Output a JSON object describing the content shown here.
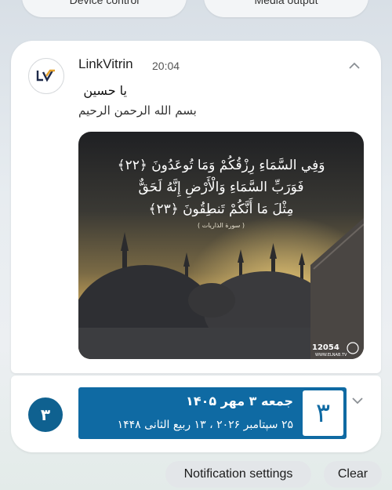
{
  "quick_settings": {
    "left_tile": "Device control",
    "right_tile": "Media output"
  },
  "notification": {
    "app_name": "LinkVitrin",
    "time": "20:04",
    "title": "یا حسین",
    "body": "بسم الله الرحمن الرحیم",
    "image": {
      "verse_line1": "وَفِي السَّمَاءِ رِزْقُكُمْ وَمَا تُوعَدُونَ ﴿٢٢﴾",
      "verse_line2": "فَوَرَبِّ السَّمَاءِ وَالْأَرْضِ إِنَّهُ لَحَقٌّ",
      "verse_line3": "مِثْلَ مَا أَنَّكُمْ تَنطِقُونَ ﴿٢٣﴾",
      "verse_ref": "( سورة الذاريات )",
      "channel_id": "12054",
      "site": "WWW.ELNAB.TV"
    }
  },
  "calendar_notification": {
    "icon_digit": "۳",
    "day_number": "۳",
    "line1": "جمعه ۳ مهر ۱۴۰۵",
    "line2": "۲۵ سپتامبر ۲۰۲۶ ، ۱۳ ربیع الثانی ۱۴۴۸"
  },
  "footer": {
    "settings_label": "Notification settings",
    "clear_label": "Clear"
  },
  "colors": {
    "calendar_blue": "#0f6aa3",
    "calendar_icon": "#0f6190"
  }
}
